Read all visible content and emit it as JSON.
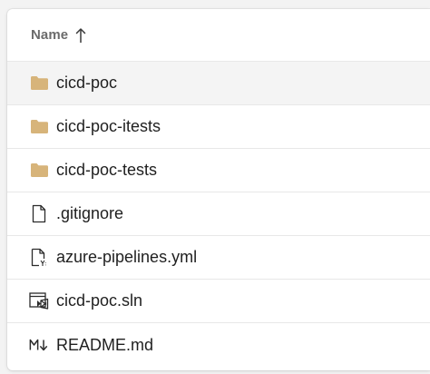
{
  "header": {
    "name_label": "Name",
    "sort_direction": "ascending"
  },
  "colors": {
    "folder": "#D7B47A",
    "text": "#1F1F1F",
    "header_text": "#6B6B6B"
  },
  "files": [
    {
      "label": "cicd-poc",
      "icon": "folder-icon",
      "selected": true
    },
    {
      "label": "cicd-poc-itests",
      "icon": "folder-icon"
    },
    {
      "label": "cicd-poc-tests",
      "icon": "folder-icon"
    },
    {
      "label": ".gitignore",
      "icon": "file-icon"
    },
    {
      "label": "azure-pipelines.yml",
      "icon": "yaml-file-icon"
    },
    {
      "label": "cicd-poc.sln",
      "icon": "visual-studio-solution-icon"
    },
    {
      "label": "README.md",
      "icon": "markdown-icon"
    }
  ]
}
